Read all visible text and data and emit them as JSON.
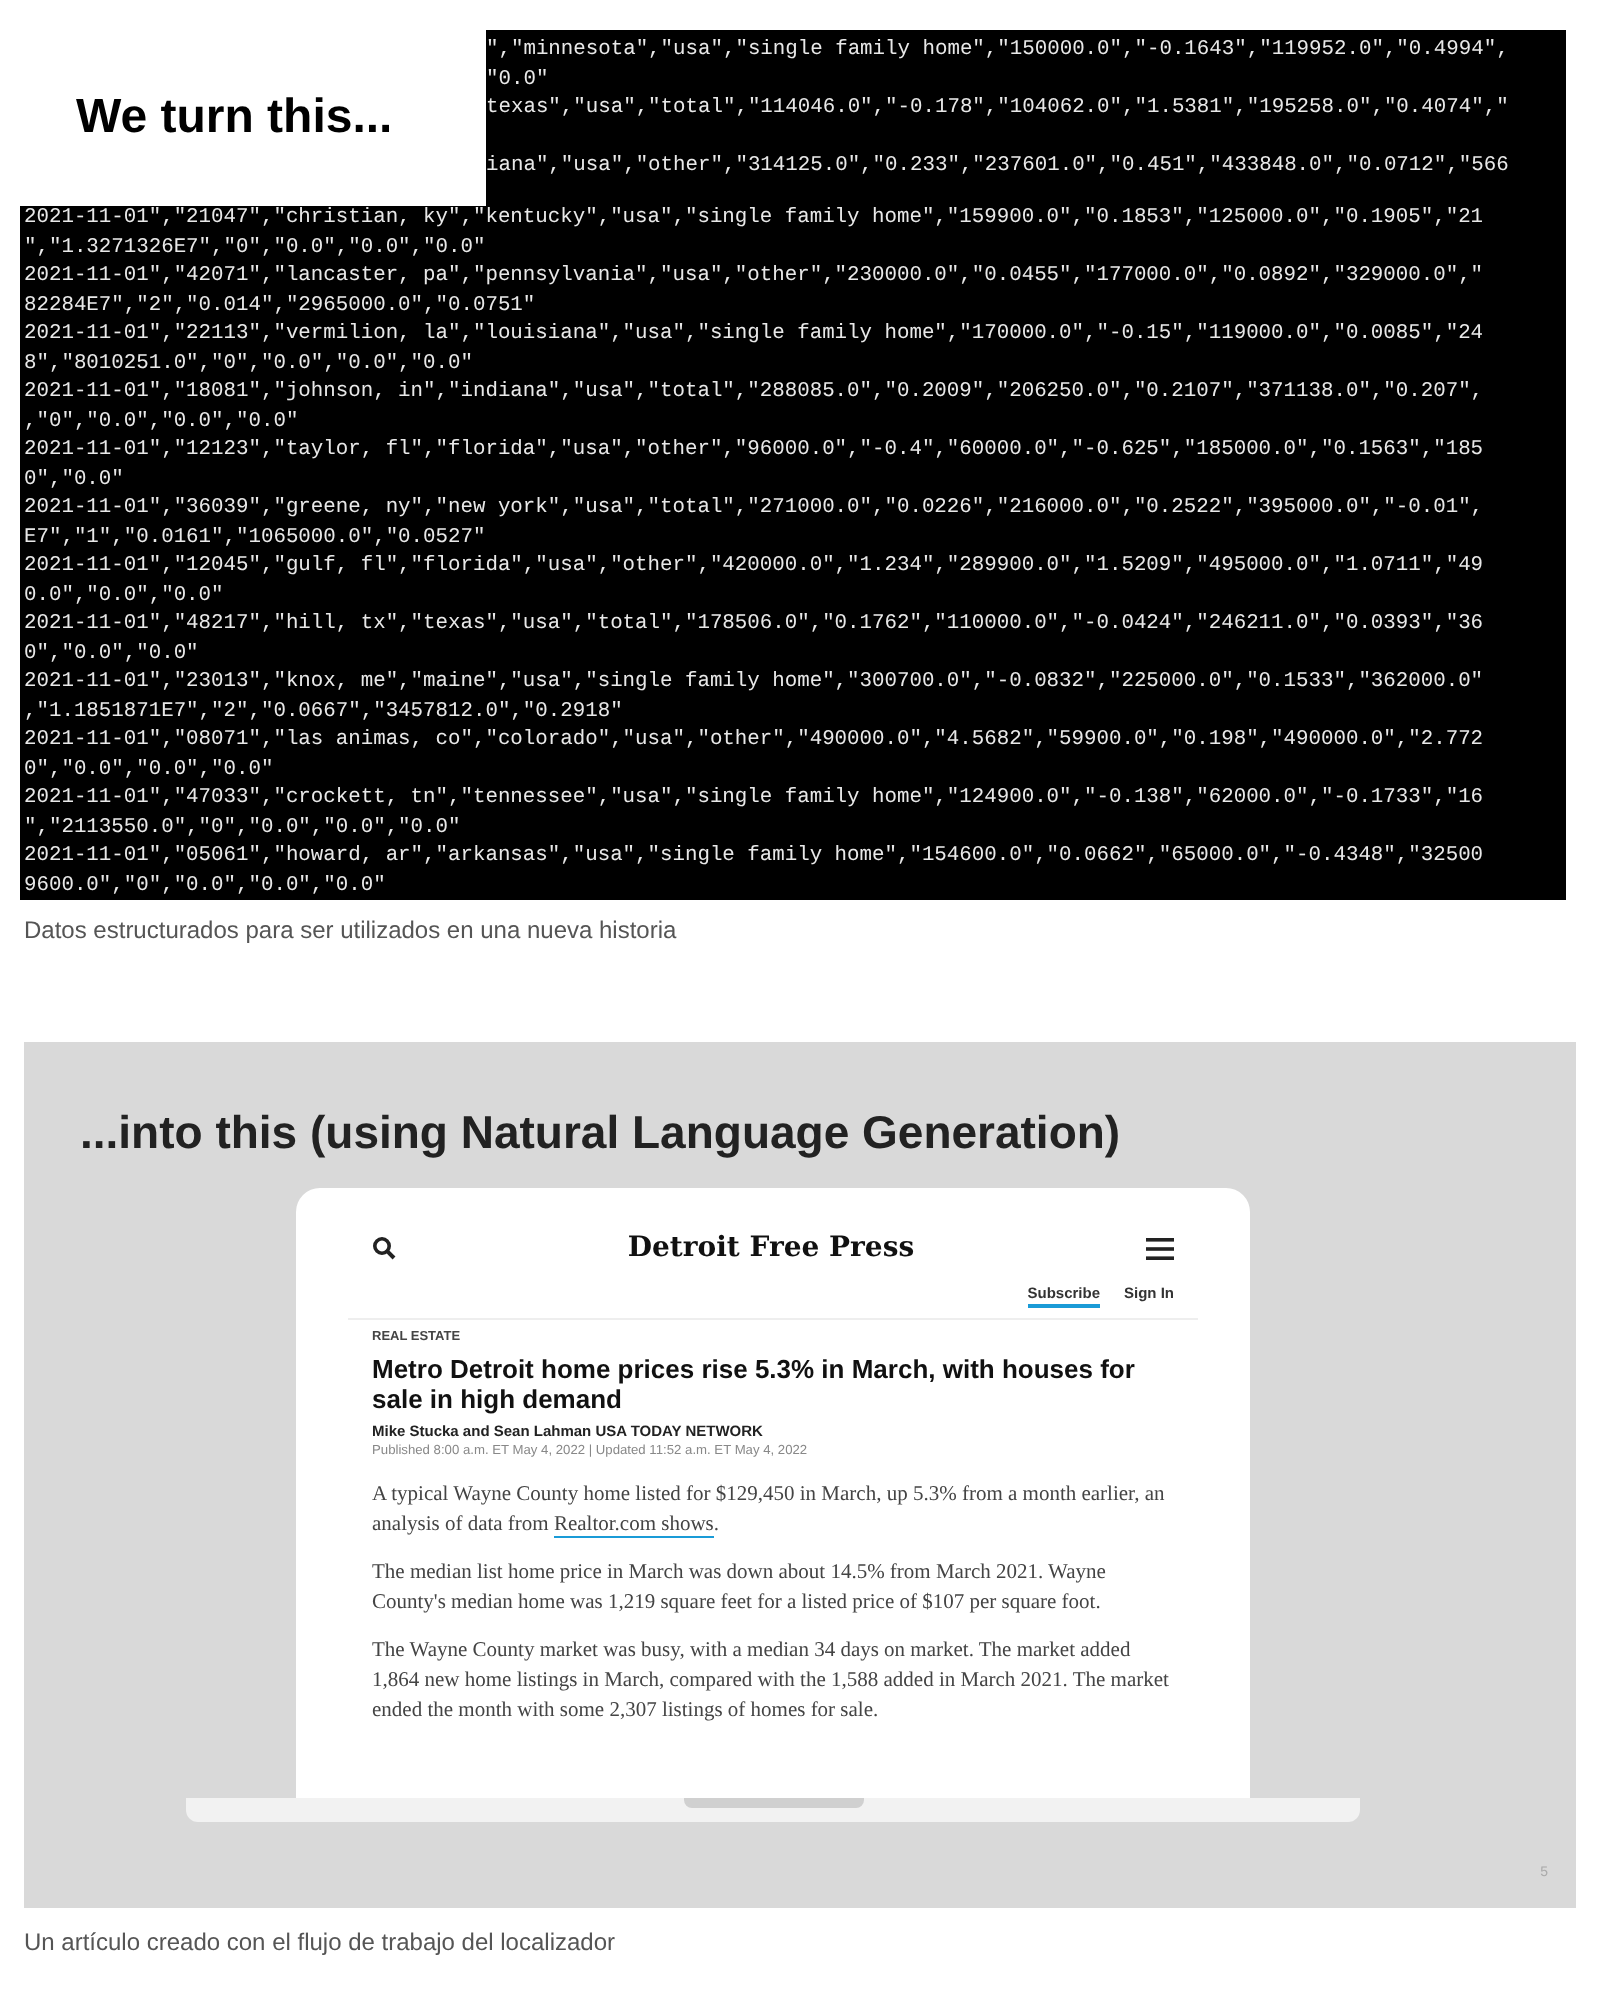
{
  "slide_1": {
    "title": "We turn this...",
    "top_fragments": [
      {
        "text": "\",\"minnesota\",\"usa\",\"single family home\",\"150000.0\",\"-0.1643\",\"119952.0\",\"0.4994\",",
        "blank_line_after": false
      },
      {
        "text": "\"0.0\"",
        "blank_line_after": false
      },
      {
        "text": "texas\",\"usa\",\"total\",\"114046.0\",\"-0.178\",\"104062.0\",\"1.5381\",\"195258.0\",\"0.4074\",\"",
        "blank_line_after": true
      },
      {
        "text": "iana\",\"usa\",\"other\",\"314125.0\",\"0.233\",\"237601.0\",\"0.451\",\"433848.0\",\"0.0712\",\"566",
        "blank_line_after": true
      }
    ],
    "lines": [
      "2021-11-01\",\"21047\",\"christian, ky\",\"kentucky\",\"usa\",\"single family home\",\"159900.0\",\"0.1853\",\"125000.0\",\"0.1905\",\"21",
      "\",\"1.3271326E7\",\"0\",\"0.0\",\"0.0\",\"0.0\"",
      "2021-11-01\",\"42071\",\"lancaster, pa\",\"pennsylvania\",\"usa\",\"other\",\"230000.0\",\"0.0455\",\"177000.0\",\"0.0892\",\"329000.0\",\"",
      "82284E7\",\"2\",\"0.014\",\"2965000.0\",\"0.0751\"",
      "2021-11-01\",\"22113\",\"vermilion, la\",\"louisiana\",\"usa\",\"single family home\",\"170000.0\",\"-0.15\",\"119000.0\",\"0.0085\",\"24",
      "8\",\"8010251.0\",\"0\",\"0.0\",\"0.0\",\"0.0\"",
      "2021-11-01\",\"18081\",\"johnson, in\",\"indiana\",\"usa\",\"total\",\"288085.0\",\"0.2009\",\"206250.0\",\"0.2107\",\"371138.0\",\"0.207\",",
      ",\"0\",\"0.0\",\"0.0\",\"0.0\"",
      "2021-11-01\",\"12123\",\"taylor, fl\",\"florida\",\"usa\",\"other\",\"96000.0\",\"-0.4\",\"60000.0\",\"-0.625\",\"185000.0\",\"0.1563\",\"185",
      "0\",\"0.0\"",
      "2021-11-01\",\"36039\",\"greene, ny\",\"new york\",\"usa\",\"total\",\"271000.0\",\"0.0226\",\"216000.0\",\"0.2522\",\"395000.0\",\"-0.01\",",
      "E7\",\"1\",\"0.0161\",\"1065000.0\",\"0.0527\"",
      "2021-11-01\",\"12045\",\"gulf, fl\",\"florida\",\"usa\",\"other\",\"420000.0\",\"1.234\",\"289900.0\",\"1.5209\",\"495000.0\",\"1.0711\",\"49",
      "0.0\",\"0.0\",\"0.0\"",
      "2021-11-01\",\"48217\",\"hill, tx\",\"texas\",\"usa\",\"total\",\"178506.0\",\"0.1762\",\"110000.0\",\"-0.0424\",\"246211.0\",\"0.0393\",\"36",
      "0\",\"0.0\",\"0.0\"",
      "2021-11-01\",\"23013\",\"knox, me\",\"maine\",\"usa\",\"single family home\",\"300700.0\",\"-0.0832\",\"225000.0\",\"0.1533\",\"362000.0\"",
      ",\"1.1851871E7\",\"2\",\"0.0667\",\"3457812.0\",\"0.2918\"",
      "2021-11-01\",\"08071\",\"las animas, co\",\"colorado\",\"usa\",\"other\",\"490000.0\",\"4.5682\",\"59900.0\",\"0.198\",\"490000.0\",\"2.772",
      "0\",\"0.0\",\"0.0\",\"0.0\"",
      "2021-11-01\",\"47033\",\"crockett, tn\",\"tennessee\",\"usa\",\"single family home\",\"124900.0\",\"-0.138\",\"62000.0\",\"-0.1733\",\"16",
      "\",\"2113550.0\",\"0\",\"0.0\",\"0.0\",\"0.0\"",
      "2021-11-01\",\"05061\",\"howard, ar\",\"arkansas\",\"usa\",\"single family home\",\"154600.0\",\"0.0662\",\"65000.0\",\"-0.4348\",\"32500",
      "9600.0\",\"0\",\"0.0\",\"0.0\",\"0.0\""
    ]
  },
  "caption_1": "Datos estructurados para ser utilizados en una nueva historia",
  "slide_2": {
    "title": "...into this (using Natural Language Generation)",
    "article": {
      "masthead": "Detroit Free Press",
      "subscribe": "Subscribe",
      "sign_in": "Sign In",
      "section": "REAL ESTATE",
      "headline": "Metro Detroit home prices rise 5.3% in March, with houses for sale in high demand",
      "byline": "Mike Stucka and Sean Lahman USA TODAY NETWORK",
      "published": "Published 8:00 a.m. ET May 4, 2022 | Updated 11:52 a.m. ET May 4, 2022",
      "paragraphs": [
        {
          "text": "A typical Wayne County home listed for $129,450 in March, up 5.3% from a month earlier, an analysis of data from",
          "link": "Realtor.com shows",
          "after": "."
        },
        {
          "text": "The median list home price in March was down about 14.5% from March 2021. Wayne County's median home was 1,219 square feet for a listed price of $107 per square foot."
        },
        {
          "text": "The Wayne County market was busy, with a median 34 days on market. The market added 1,864 new home listings in March, compared with the 1,588 added in March 2021. The market ended the month with some 2,307 listings of homes for sale."
        }
      ]
    },
    "page_number": "5"
  },
  "caption_2": "Un artículo creado con el flujo de trabajo del localizador"
}
